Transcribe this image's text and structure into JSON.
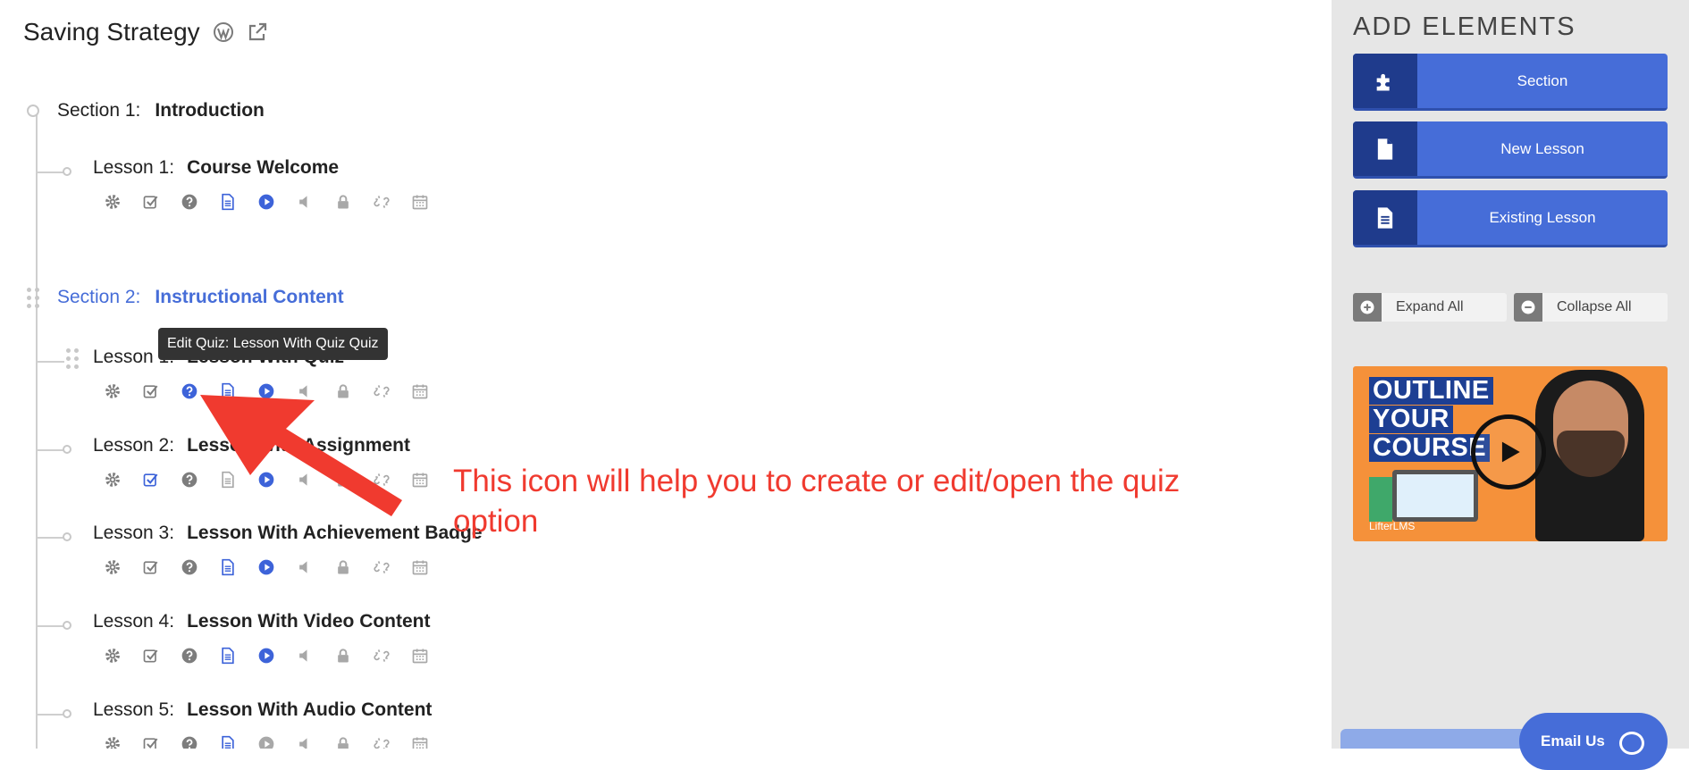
{
  "course": {
    "title": "Saving Strategy"
  },
  "sections": [
    {
      "label": "Section 1:",
      "name": "Introduction"
    },
    {
      "label": "Section 2:",
      "name": "Instructional Content"
    }
  ],
  "lessons": [
    {
      "label": "Lesson 1:",
      "name": "Course Welcome"
    },
    {
      "label": "Lesson 1:",
      "name": "Lesson With Quiz"
    },
    {
      "label": "Lesson 2:",
      "name": "Lesson With Assignment"
    },
    {
      "label": "Lesson 3:",
      "name": "Lesson With Achievement Badge"
    },
    {
      "label": "Lesson 4:",
      "name": "Lesson With Video Content"
    },
    {
      "label": "Lesson 5:",
      "name": "Lesson With Audio Content"
    }
  ],
  "tooltip": "Edit Quiz: Lesson With Quiz Quiz",
  "annotation": "This icon will help you to create or edit/open the quiz option",
  "sidebar": {
    "heading": "ADD ELEMENTS",
    "buttons": [
      "Section",
      "New Lesson",
      "Existing Lesson"
    ],
    "expand_all": "Expand All",
    "collapse_all": "Collapse All",
    "video": {
      "line1": "OUTLINE",
      "line2": "YOUR",
      "line3": "COURSE",
      "brand": "LifterLMS"
    }
  },
  "email_button": "Email Us",
  "colors": {
    "accent": "#466dd8",
    "accent_dark": "#1f3b8c",
    "annotation_red": "#f03a2f",
    "video_orange": "#f5913a"
  }
}
